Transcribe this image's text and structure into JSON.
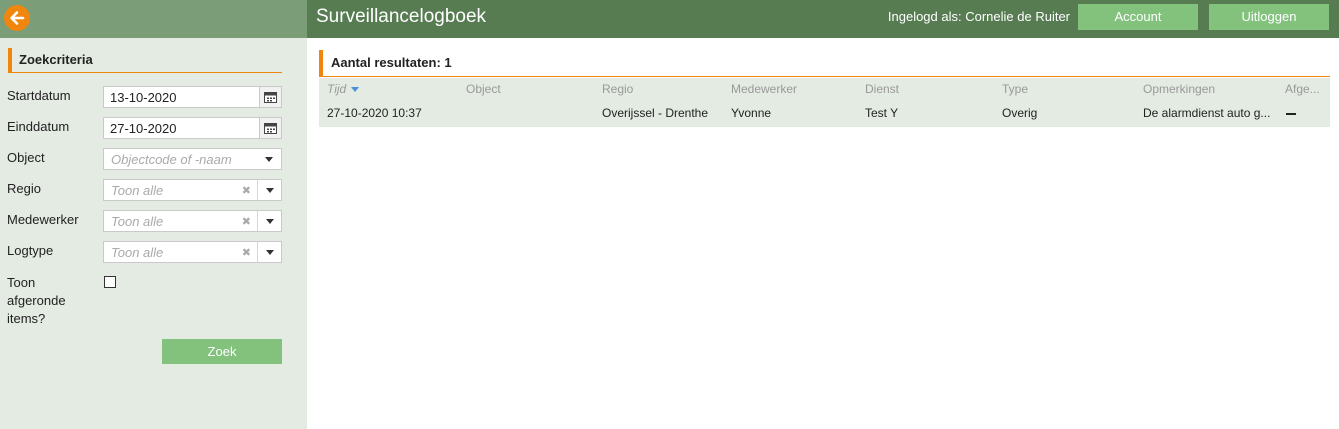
{
  "header": {
    "title": "Surveillancelogboek",
    "logged_in": "Ingelogd als: Cornelie de Ruiter",
    "account_label": "Account",
    "logout_label": "Uitloggen",
    "back_icon": "arrow-left-icon",
    "brand_color": "#577c52",
    "accent_color": "#f0860d",
    "button_color": "#82c27d"
  },
  "search": {
    "title": "Zoekcriteria",
    "startdate_label": "Startdatum",
    "startdate_value": "13-10-2020",
    "enddate_label": "Einddatum",
    "enddate_value": "27-10-2020",
    "object_label": "Object",
    "object_placeholder": "Objectcode of -naam",
    "regio_label": "Regio",
    "regio_placeholder": "Toon alle",
    "medewerker_label": "Medewerker",
    "medewerker_placeholder": "Toon alle",
    "logtype_label": "Logtype",
    "logtype_placeholder": "Toon alle",
    "completed_label_1": "Toon",
    "completed_label_2": "afgeronde",
    "completed_label_3": "items?",
    "completed_checked": false,
    "search_button": "Zoek"
  },
  "results": {
    "title": "Aantal resultaten: 1",
    "columns": [
      "Tijd",
      "Object",
      "Regio",
      "Medewerker",
      "Dienst",
      "Type",
      "Opmerkingen",
      "Afge..."
    ],
    "sorted_column": "Tijd",
    "rows": [
      {
        "tijd": "27-10-2020 10:37",
        "object": "",
        "regio": "Overijssel - Drenthe",
        "medewerker": "Yvonne",
        "dienst": "Test Y",
        "type": "Overig",
        "opmerkingen": "De alarmdienst auto g...",
        "afgerond": "dash-icon"
      }
    ]
  }
}
